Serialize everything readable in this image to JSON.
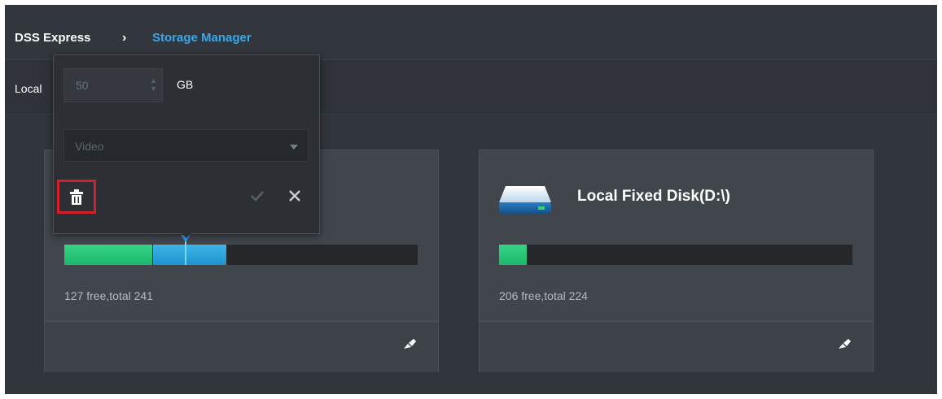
{
  "breadcrumb": {
    "app": "DSS Express",
    "separator": "›",
    "current": "Storage Manager"
  },
  "tab": {
    "label": "Local"
  },
  "popup": {
    "size_value": "50",
    "unit": "GB",
    "type_value": "Video"
  },
  "disks": [
    {
      "title_partial": "\\)",
      "free_text": "127 free,total 241",
      "segments": [
        {
          "color": "green",
          "fraction": 0.25
        },
        {
          "color": "blue",
          "fraction": 0.21
        }
      ]
    },
    {
      "title": "Local Fixed Disk(D:\\)",
      "free_text": "206 free,total 224",
      "segments": [
        {
          "color": "green",
          "fraction": 0.08
        }
      ]
    }
  ],
  "colors": {
    "accent": "#3aa8e8",
    "used_green": "#26c27a",
    "used_blue": "#2aa3dc",
    "highlight_red": "#d2202a"
  }
}
